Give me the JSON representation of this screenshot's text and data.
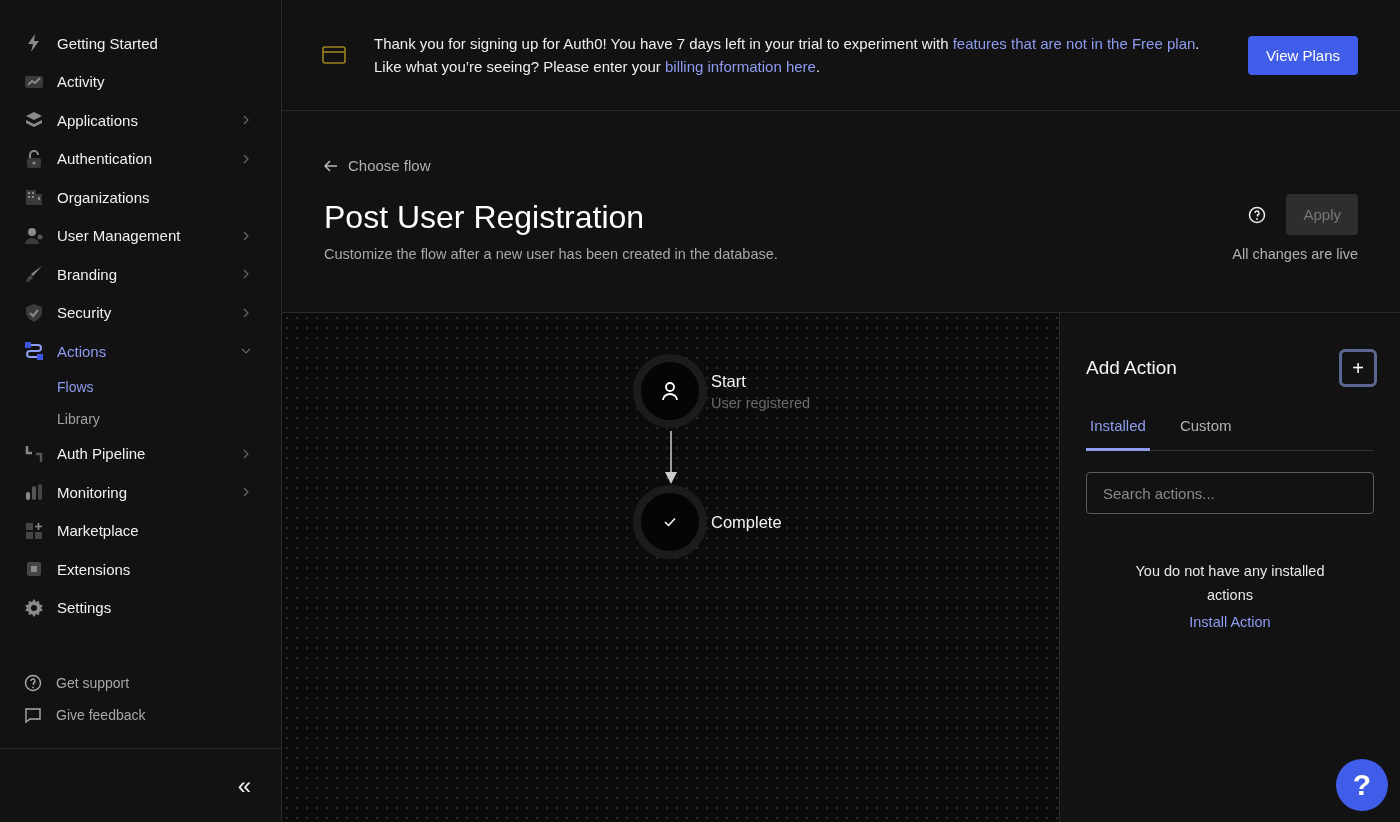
{
  "sidebar": {
    "items": [
      {
        "label": "Getting Started",
        "kind": "link",
        "selected": false
      },
      {
        "label": "Activity",
        "kind": "link",
        "selected": false
      },
      {
        "label": "Applications",
        "kind": "group",
        "expanded": false,
        "selected": false
      },
      {
        "label": "Authentication",
        "kind": "group",
        "expanded": false,
        "selected": false
      },
      {
        "label": "Organizations",
        "kind": "link",
        "selected": false
      },
      {
        "label": "User Management",
        "kind": "group",
        "expanded": false,
        "selected": false
      },
      {
        "label": "Branding",
        "kind": "group",
        "expanded": false,
        "selected": false
      },
      {
        "label": "Security",
        "kind": "group",
        "expanded": false,
        "selected": false
      },
      {
        "label": "Actions",
        "kind": "group",
        "expanded": true,
        "selected": true,
        "children": [
          {
            "label": "Flows",
            "selected": true
          },
          {
            "label": "Library",
            "selected": false
          }
        ]
      },
      {
        "label": "Auth Pipeline",
        "kind": "group",
        "expanded": false,
        "selected": false
      },
      {
        "label": "Monitoring",
        "kind": "group",
        "expanded": false,
        "selected": false
      },
      {
        "label": "Marketplace",
        "kind": "link",
        "selected": false
      },
      {
        "label": "Extensions",
        "kind": "link",
        "selected": false
      },
      {
        "label": "Settings",
        "kind": "link",
        "selected": false
      }
    ],
    "footer_links": [
      "Get support",
      "Give feedback"
    ],
    "collapse_button": "«"
  },
  "banner": {
    "parts": [
      {
        "kind": "text",
        "text": "Thank you for signing up for Auth0! You have 7 days left in your trial to experiment with "
      },
      {
        "kind": "link",
        "text": "features that are not in the Free plan"
      },
      {
        "kind": "text",
        "text": ". Like what you’re seeing? Please enter your "
      },
      {
        "kind": "link",
        "text": "billing information here"
      },
      {
        "kind": "text",
        "text": "."
      }
    ],
    "button": "View Plans"
  },
  "header": {
    "back_link": "Choose flow",
    "title": "Post User Registration",
    "description": "Customize the flow after a new user has been created in the database.",
    "apply_button": "Apply",
    "apply_disabled": true,
    "status": "All changes are live"
  },
  "flow": {
    "nodes": [
      {
        "kind": "start",
        "title": "Start",
        "subtitle": "User registered"
      },
      {
        "kind": "end",
        "title": "Complete"
      }
    ]
  },
  "panel": {
    "title": "Add Action",
    "add_button": "+",
    "tabs": [
      {
        "label": "Installed",
        "selected": true
      },
      {
        "label": "Custom",
        "selected": false
      }
    ],
    "search": {
      "placeholder": "Search actions..."
    },
    "empty_message": "You do not have any installed actions",
    "install_link": "Install Action"
  },
  "help_button": "?"
}
